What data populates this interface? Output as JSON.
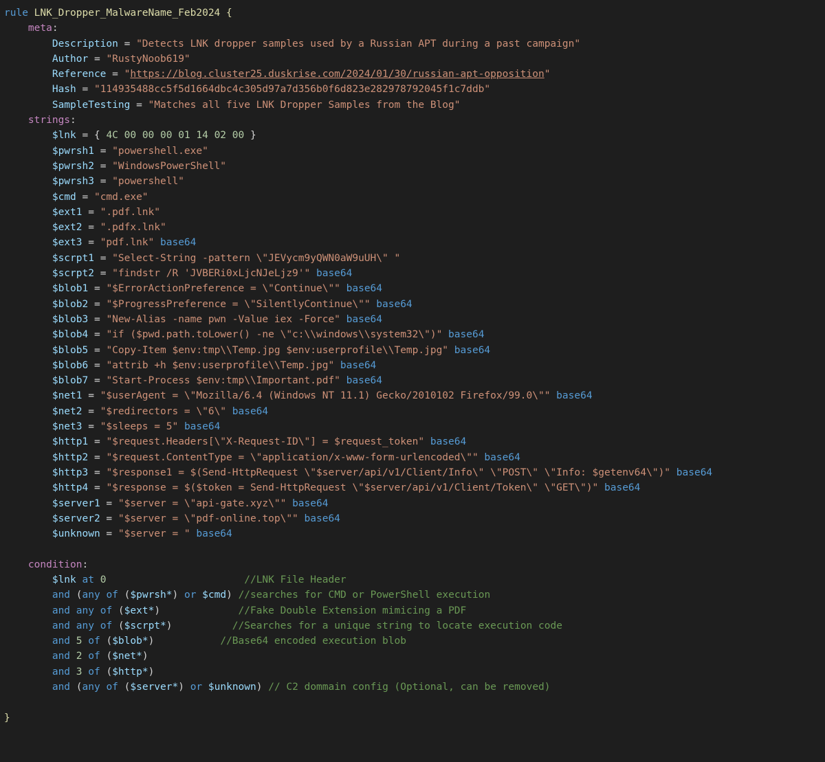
{
  "rule_keyword": "rule",
  "rule_name": "LNK_Dropper_MalwareName_Feb2024",
  "open_brace": "{",
  "close_brace": "}",
  "meta_label": "meta",
  "strings_label": "strings",
  "condition_label": "condition",
  "colon": ":",
  "eq": "=",
  "meta": {
    "desc_key": "Description",
    "desc_val": "\"Detects LNK dropper samples used by a Russian APT during a past campaign\"",
    "author_key": "Author",
    "author_val": "\"RustyNoob619\"",
    "ref_key": "Reference",
    "ref_prefix": "\"",
    "ref_url": "https://blog.cluster25.duskrise.com/2024/01/30/russian-apt-opposition",
    "ref_suffix": "\"",
    "hash_key": "Hash",
    "hash_val": "\"114935488cc5f5d1664dbc4c305d97a7d356b0f6d823e282978792045f1c7ddb\"",
    "sample_key": "SampleTesting",
    "sample_val": "\"Matches all five LNK Dropper Samples from the Blog\""
  },
  "strings": {
    "lnk_id": "$lnk",
    "lnk_open": "{ ",
    "lnk_hex": "4C 00 00 00 01 14 02 00",
    "lnk_close": " }",
    "pwrsh1_id": "$pwrsh1",
    "pwrsh1_val": "\"powershell.exe\"",
    "pwrsh2_id": "$pwrsh2",
    "pwrsh2_val": "\"WindowsPowerShell\"",
    "pwrsh3_id": "$pwrsh3",
    "pwrsh3_val": "\"powershell\"",
    "cmd_id": "$cmd",
    "cmd_val": "\"cmd.exe\"",
    "ext1_id": "$ext1",
    "ext1_val": "\".pdf.lnk\"",
    "ext2_id": "$ext2",
    "ext2_val": "\".pdfx.lnk\"",
    "ext3_id": "$ext3",
    "ext3_val": "\"pdf.lnk\"",
    "scrpt1_id": "$scrpt1",
    "scrpt1_val": "\"Select-String -pattern \\\"JEVycm9yQWN0aW9uUH\\\" \"",
    "scrpt2_id": "$scrpt2",
    "scrpt2_val": "\"findstr /R 'JVBERi0xLjcNJeLjz9'\"",
    "blob1_id": "$blob1",
    "blob1_val": "\"$ErrorActionPreference = \\\"Continue\\\"\"",
    "blob2_id": "$blob2",
    "blob2_val": "\"$ProgressPreference = \\\"SilentlyContinue\\\"\"",
    "blob3_id": "$blob3",
    "blob3_val": "\"New-Alias -name pwn -Value iex -Force\"",
    "blob4_id": "$blob4",
    "blob4_val": "\"if ($pwd.path.toLower() -ne \\\"c:\\\\windows\\\\system32\\\")\"",
    "blob5_id": "$blob5",
    "blob5_val": "\"Copy-Item $env:tmp\\\\Temp.jpg $env:userprofile\\\\Temp.jpg\"",
    "blob6_id": "$blob6",
    "blob6_val": "\"attrib +h $env:userprofile\\\\Temp.jpg\"",
    "blob7_id": "$blob7",
    "blob7_val": "\"Start-Process $env:tmp\\\\Important.pdf\"",
    "net1_id": "$net1",
    "net1_val": "\"$userAgent = \\\"Mozilla/6.4 (Windows NT 11.1) Gecko/2010102 Firefox/99.0\\\"\"",
    "net2_id": "$net2",
    "net2_val": "\"$redirectors = \\\"6\\\"",
    "net3_id": "$net3",
    "net3_val": "\"$sleeps = 5\"",
    "http1_id": "$http1",
    "http1_val": "\"$request.Headers[\\\"X-Request-ID\\\"] = $request_token\"",
    "http2_id": "$http2",
    "http2_val": "\"$request.ContentType = \\\"application/x-www-form-urlencoded\\\"\"",
    "http3_id": "$http3",
    "http3_val": "\"$response1 = $(Send-HttpRequest \\\"$server/api/v1/Client/Info\\\" \\\"POST\\\" \\\"Info: $getenv64\\\")\"",
    "http4_id": "$http4",
    "http4_val": "\"$response = $($token = Send-HttpRequest \\\"$server/api/v1/Client/Token\\\" \\\"GET\\\")\"",
    "server1_id": "$server1",
    "server1_val": "\"$server = \\\"api-gate.xyz\\\"\"",
    "server2_id": "$server2",
    "server2_val": "\"$server = \\\"pdf-online.top\\\"\"",
    "unknown_id": "$unknown",
    "unknown_val": "\"$server = \""
  },
  "b64": "base64",
  "cond": {
    "lnk": "$lnk",
    "at": "at",
    "zero": "0",
    "c1": "//LNK File Header",
    "and": "and",
    "any": "any",
    "of": "of",
    "or": "or",
    "pwrsh": "$pwrsh*",
    "cmd": "$cmd",
    "c2": "//searches for CMD or PowerShell execution",
    "ext": "$ext*",
    "c3": "//Fake Double Extension mimicing a PDF",
    "scrpt": "$scrpt*",
    "c4": "//Searches for a unique string to locate execution code",
    "five": "5",
    "blob": "$blob*",
    "c5": "//Base64 encoded execution blob",
    "two": "2",
    "net": "$net*",
    "three": "3",
    "http": "$http*",
    "server": "$server*",
    "unknown": "$unknown",
    "c6": "// C2 dommain config (Optional, can be removed)"
  }
}
